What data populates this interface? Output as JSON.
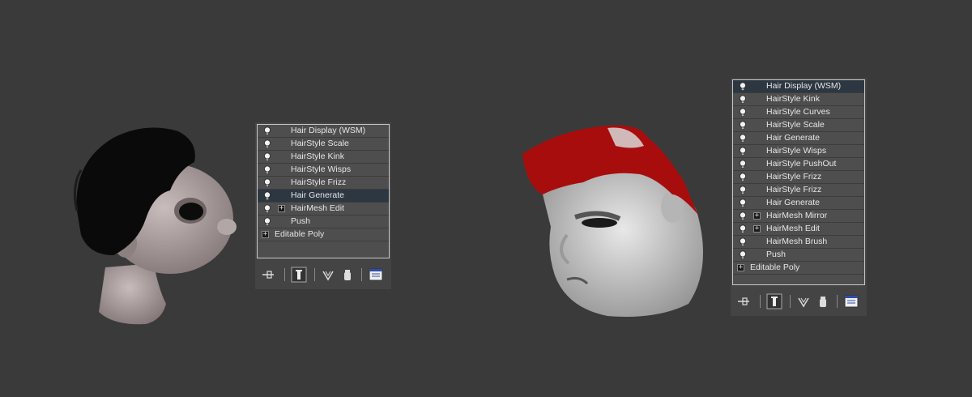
{
  "left_panel": {
    "stack": [
      {
        "label": "Hair Display (WSM)",
        "bulb": true,
        "expand": false,
        "selected": false
      },
      {
        "label": "HairStyle Scale",
        "bulb": true,
        "expand": false,
        "selected": false
      },
      {
        "label": "HairStyle Kink",
        "bulb": true,
        "expand": false,
        "selected": false
      },
      {
        "label": "HairStyle Wisps",
        "bulb": true,
        "expand": false,
        "selected": false
      },
      {
        "label": "HairStyle Frizz",
        "bulb": true,
        "expand": false,
        "selected": false
      },
      {
        "label": "Hair Generate",
        "bulb": true,
        "expand": false,
        "selected": true
      },
      {
        "label": "HairMesh Edit",
        "bulb": true,
        "expand": true,
        "selected": false
      },
      {
        "label": "Push",
        "bulb": true,
        "expand": false,
        "selected": false
      }
    ],
    "base": "Editable Poly"
  },
  "right_panel": {
    "stack": [
      {
        "label": "Hair Display (WSM)",
        "bulb": true,
        "expand": false,
        "selected": true
      },
      {
        "label": "HairStyle Kink",
        "bulb": true,
        "expand": false,
        "selected": false
      },
      {
        "label": "HairStyle Curves",
        "bulb": true,
        "expand": false,
        "selected": false
      },
      {
        "label": "HairStyle Scale",
        "bulb": true,
        "expand": false,
        "selected": false
      },
      {
        "label": "Hair Generate",
        "bulb": true,
        "expand": false,
        "selected": false
      },
      {
        "label": "HairStyle Wisps",
        "bulb": true,
        "expand": false,
        "selected": false
      },
      {
        "label": "HairStyle PushOut",
        "bulb": true,
        "expand": false,
        "selected": false
      },
      {
        "label": "HairStyle Frizz",
        "bulb": true,
        "expand": false,
        "selected": false
      },
      {
        "label": "HairStyle Frizz",
        "bulb": true,
        "expand": false,
        "selected": false
      },
      {
        "label": "Hair Generate",
        "bulb": true,
        "expand": false,
        "selected": false
      },
      {
        "label": "HairMesh Mirror",
        "bulb": true,
        "expand": true,
        "selected": false
      },
      {
        "label": "HairMesh Edit",
        "bulb": true,
        "expand": true,
        "selected": false
      },
      {
        "label": "HairMesh Brush",
        "bulb": true,
        "expand": false,
        "selected": false
      },
      {
        "label": "Push",
        "bulb": true,
        "expand": false,
        "selected": false
      }
    ],
    "base": "Editable Poly"
  },
  "toolbar": {
    "icons": [
      "pin-stack-icon",
      "show-end-result-icon",
      "make-unique-icon",
      "remove-modifier-icon",
      "configure-modifier-sets-icon"
    ]
  },
  "colors": {
    "viewport_bg": "#3a3a3a",
    "panel_bg": "#444444",
    "list_bg": "#4e4e4e",
    "selected_row": "#2d3742",
    "hair_red": "#a80d0d"
  },
  "renders": {
    "left": "cartoon-head-dark-curly-hair",
    "right": "cartoon-head-red-spiky-hair"
  }
}
